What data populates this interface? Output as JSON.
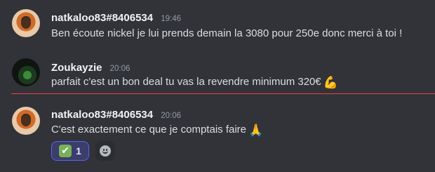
{
  "messages": [
    {
      "username": "natkaloo83#8406534",
      "timestamp": "19:46",
      "text": "Ben écoute nickel je lui prends demain la 3080 pour 250e donc merci à toi !"
    },
    {
      "username": "Zoukayzie",
      "timestamp": "20:06",
      "text": "parfait c'est un bon deal tu vas la revendre minimum 320€",
      "emoji": "💪"
    },
    {
      "username": "natkaloo83#8406534",
      "timestamp": "20:06",
      "text": "C'est exactement ce que je comptais faire",
      "emoji": "🙏",
      "reaction": {
        "emoji": "✔",
        "count": "1"
      }
    }
  ],
  "colors": {
    "background": "#313338",
    "divider": "#f23f42",
    "reaction_accent": "#5865f2"
  }
}
